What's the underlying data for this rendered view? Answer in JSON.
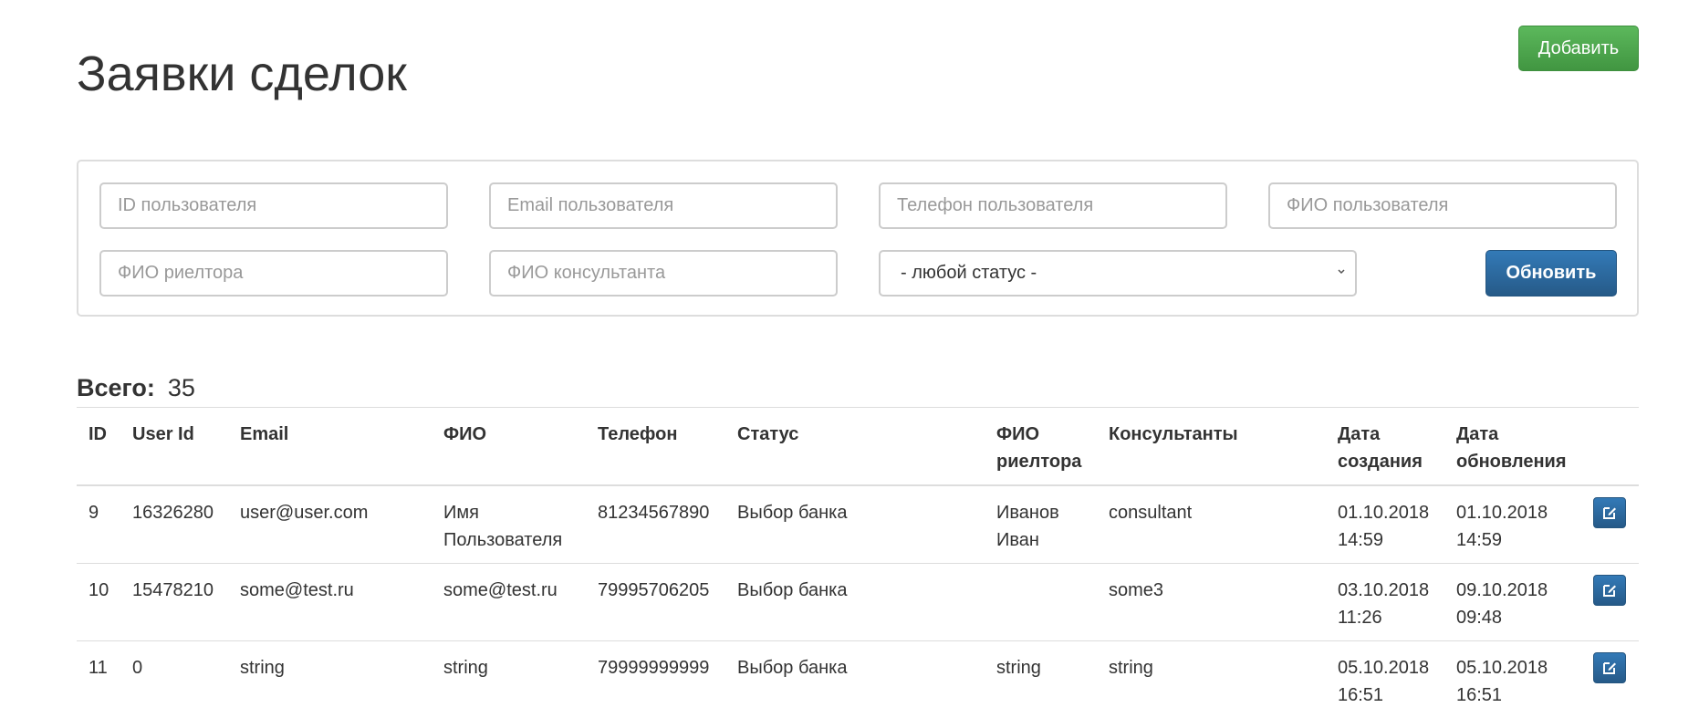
{
  "header": {
    "title": "Заявки сделок",
    "add_label": "Добавить"
  },
  "filters": {
    "user_id_placeholder": "ID пользователя",
    "email_placeholder": "Email пользователя",
    "phone_placeholder": "Телефон пользователя",
    "fio_placeholder": "ФИО пользователя",
    "realtor_placeholder": "ФИО риелтора",
    "consultant_placeholder": "ФИО консультанта",
    "status_selected": "- любой статус -",
    "refresh_label": "Обновить"
  },
  "summary": {
    "total_label": "Всего:",
    "total_value": "35"
  },
  "table": {
    "columns": {
      "id": "ID",
      "user_id": "User Id",
      "email": "Email",
      "fio": "ФИО",
      "phone": "Телефон",
      "status": "Статус",
      "realtor": "ФИО\nриелтора",
      "consultants": "Консультанты",
      "created": "Дата\nсоздания",
      "updated": "Дата\nобновления"
    },
    "rows": [
      {
        "id": "9",
        "user_id": "16326280",
        "email": "user@user.com",
        "fio": "Имя\nПользователя",
        "phone": "81234567890",
        "status": "Выбор банка",
        "realtor": "Иванов\nИван",
        "consultants": "consultant",
        "created": "01.10.2018\n14:59",
        "updated": "01.10.2018\n14:59"
      },
      {
        "id": "10",
        "user_id": "15478210",
        "email": "some@test.ru",
        "fio": "some@test.ru",
        "phone": "79995706205",
        "status": "Выбор банка",
        "realtor": "",
        "consultants": "some3",
        "created": "03.10.2018\n11:26",
        "updated": "09.10.2018\n09:48"
      },
      {
        "id": "11",
        "user_id": "0",
        "email": "string",
        "fio": "string",
        "phone": "79999999999",
        "status": "Выбор банка",
        "realtor": "string",
        "consultants": "string",
        "created": "05.10.2018\n16:51",
        "updated": "05.10.2018\n16:51"
      }
    ]
  },
  "icons": {
    "edit": "edit-icon",
    "select_arrow": "chevron-down-icon"
  },
  "colors": {
    "success": "#5cb85c",
    "primary": "#337ab7"
  }
}
